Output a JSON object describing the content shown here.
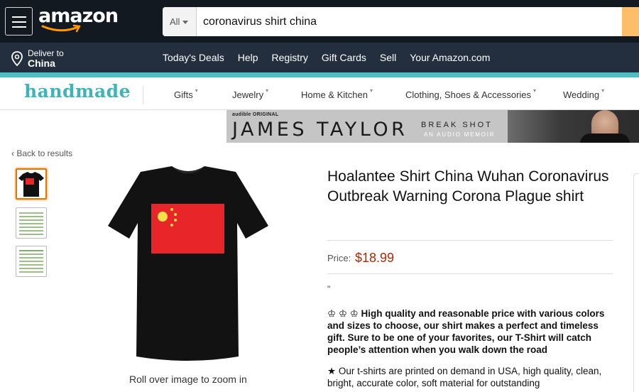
{
  "header": {
    "logo_text": "amazon",
    "search": {
      "category": "All",
      "query": "coronavirus shirt china"
    },
    "deliver": {
      "line1": "Deliver to",
      "line2": "China"
    },
    "nav_links": [
      "Today's Deals",
      "Help",
      "Registry",
      "Gift Cards",
      "Sell",
      "Your Amazon.com"
    ],
    "accent_color": "#4bbfc2"
  },
  "handmade_nav": {
    "logo": "handmade",
    "links": [
      "Gifts",
      "Jewelry",
      "Home & Kitchen",
      "Clothing, Shoes & Accessories",
      "Wedding"
    ]
  },
  "ad_banner": {
    "badge": "audible ORIGINAL",
    "name": "JAMES TAYLOR",
    "tagline1": "BREAK SHOT",
    "tagline2": "AN AUDIO MEMOIR"
  },
  "product": {
    "back_link": "‹ Back to results",
    "title": "Hoalantee Shirt China Wuhan Coronavirus Outbreak Warning Corona Plague shirt",
    "price_label": "Price:",
    "price": "$18.99",
    "quote_mark": "\"",
    "zoom_hint": "Roll over image to zoom in",
    "bullet1": "♔ ♔ ♔  High quality and reasonable price with various colors and sizes to choose, our shirt makes a perfect and timeless gift. Sure to be one of your favorites, our T-Shirt will catch people’s attention when you walk down the road",
    "bullet2": "★ Our t-shirts are printed on demand in USA, high quality, clean, bright, accurate color, soft material for outstanding",
    "shirt_color": "#111111",
    "flag_color": "#e8262a",
    "star_color": "#f5e04a"
  }
}
